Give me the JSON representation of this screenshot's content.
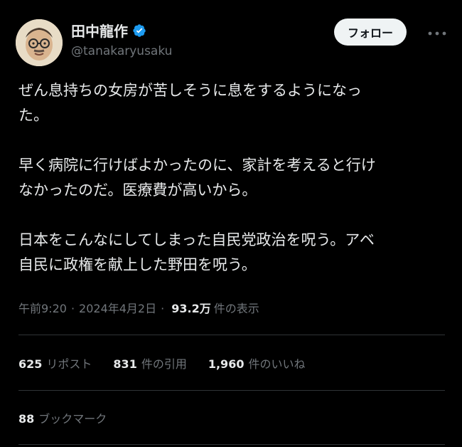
{
  "author": {
    "name": "田中龍作",
    "handle": "@tanakaryusaku",
    "verified": true
  },
  "follow_button": "フォロー",
  "tweet": {
    "paragraphs": [
      "ぜん息持ちの女房が苦しそうに息をするようになっ\nた。",
      "早く病院に行けばよかったのに、家計を考えると行け\nなかったのだ。医療費が高いから。",
      "日本をこんなにしてしまった自民党政治を呪う。アベ\n自民に政権を献上した野田を呪う。"
    ]
  },
  "meta": {
    "time": "午前9:20",
    "dot": "·",
    "date": "2024年4月2日",
    "views": "93.2万",
    "views_label": "件の表示"
  },
  "stats": {
    "reposts": {
      "count": "625",
      "label": "リポスト"
    },
    "quotes": {
      "count": "831",
      "label": "件の引用"
    },
    "likes": {
      "count": "1,960",
      "label": "件のいいね"
    },
    "bookmarks": {
      "count": "88",
      "label": "ブックマーク"
    }
  },
  "colors": {
    "background": "#000000",
    "text": "#e7e9ea",
    "secondary": "#71767b",
    "verified": "#1d9bf0",
    "divider": "#2f3336",
    "follow_bg": "#eff3f4"
  },
  "icons": [
    "verified-badge-icon",
    "more-options-icon"
  ]
}
